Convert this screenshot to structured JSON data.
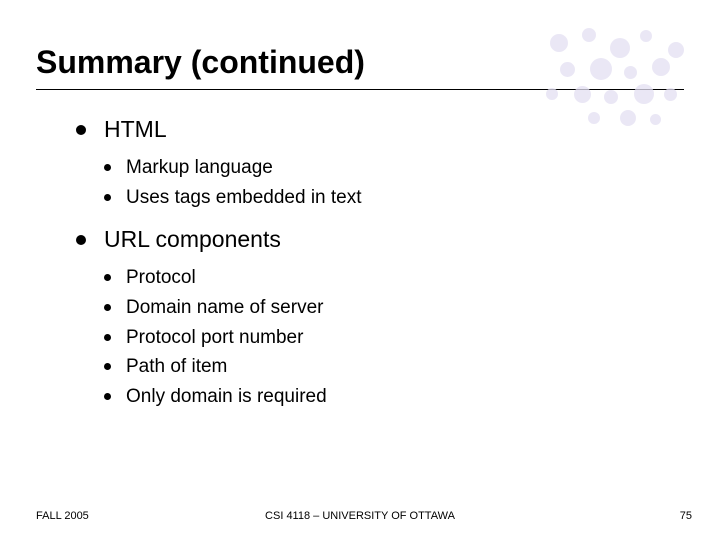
{
  "title": "Summary (continued)",
  "sections": [
    {
      "heading": "HTML",
      "items": [
        "Markup language",
        "Uses tags embedded in text"
      ]
    },
    {
      "heading": "URL components",
      "items": [
        "Protocol",
        "Domain name of server",
        "Protocol port number",
        "Path of item",
        "Only domain is required"
      ]
    }
  ],
  "footer": {
    "left": "FALL 2005",
    "center": "CSI 4118 – UNIVERSITY OF OTTAWA",
    "right": "75"
  }
}
